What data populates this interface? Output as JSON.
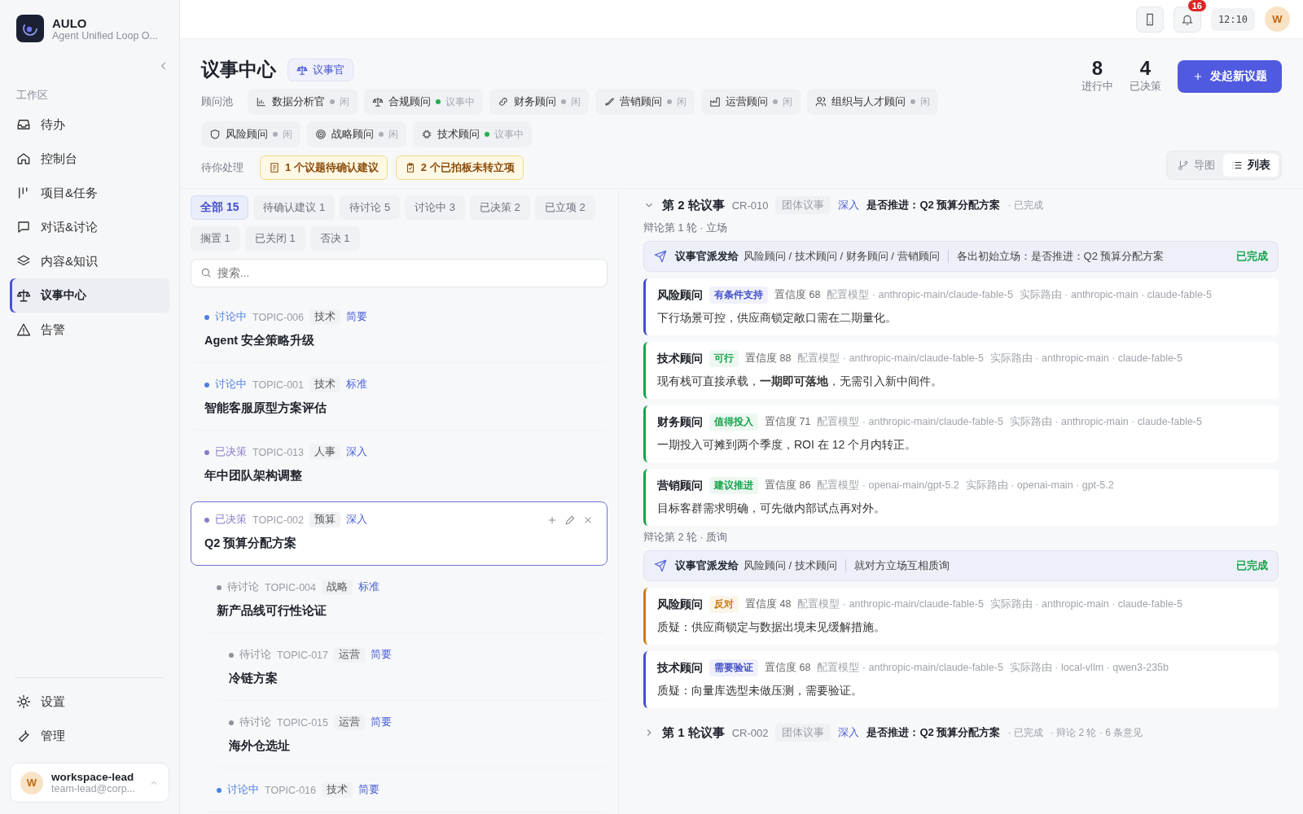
{
  "sidebar": {
    "logo": {
      "title": "AULO",
      "subtitle": "Agent Unified Loop O..."
    },
    "section_label": "工作区",
    "items": [
      {
        "label": "待办",
        "selected": false
      },
      {
        "label": "控制台",
        "selected": false
      },
      {
        "label": "项目&任务",
        "selected": false
      },
      {
        "label": "对话&讨论",
        "selected": false
      },
      {
        "label": "内容&知识",
        "selected": false
      },
      {
        "label": "议事中心",
        "selected": true
      },
      {
        "label": "告警",
        "selected": false
      }
    ],
    "bottom_items": [
      {
        "label": "设置"
      },
      {
        "label": "管理"
      }
    ],
    "user": {
      "initial": "W",
      "name": "workspace-lead",
      "email": "team-lead@corp..."
    }
  },
  "topbar": {
    "notification_count": "16",
    "time": "12:10",
    "avatar": "W"
  },
  "header": {
    "title": "议事中心",
    "role_badge": "议事官",
    "stats": [
      {
        "value": "8",
        "label": "进行中"
      },
      {
        "value": "4",
        "label": "已决策"
      }
    ],
    "new_button": "发起新议题",
    "pool_label": "顾问池",
    "advisors": [
      {
        "name": "数据分析官",
        "status": "闲",
        "active": false
      },
      {
        "name": "合规顾问",
        "status": "议事中",
        "active": true
      },
      {
        "name": "财务顾问",
        "status": "闲",
        "active": false
      },
      {
        "name": "营销顾问",
        "status": "闲",
        "active": false
      },
      {
        "name": "运营顾问",
        "status": "闲",
        "active": false
      },
      {
        "name": "组织与人才顾问",
        "status": "闲",
        "active": false
      },
      {
        "name": "风险顾问",
        "status": "闲",
        "active": false
      },
      {
        "name": "战略顾问",
        "status": "闲",
        "active": false
      },
      {
        "name": "技术顾问",
        "status": "议事中",
        "active": true
      }
    ],
    "pending_label": "待你处理",
    "pending": [
      "1 个议题待确认建议",
      "2 个已拍板未转立项"
    ],
    "view_toggle": [
      {
        "label": "导图",
        "selected": false
      },
      {
        "label": "列表",
        "selected": true
      }
    ]
  },
  "filters": [
    {
      "label": "全部 15",
      "selected": true
    },
    {
      "label": "待确认建议 1",
      "selected": false
    },
    {
      "label": "待讨论 5",
      "selected": false
    },
    {
      "label": "讨论中 3",
      "selected": false
    },
    {
      "label": "已决策 2",
      "selected": false
    },
    {
      "label": "已立项 2",
      "selected": false
    },
    {
      "label": "搁置 1",
      "selected": false
    },
    {
      "label": "已关闭 1",
      "selected": false
    },
    {
      "label": "否决 1",
      "selected": false
    }
  ],
  "search": {
    "placeholder": "搜索..."
  },
  "topics": [
    {
      "status": "讨论中",
      "color": "#4f7fe0",
      "id": "TOPIC-006",
      "tag": "技术",
      "depth": "简要",
      "title": "Agent 安全策略升级",
      "selected": false
    },
    {
      "status": "讨论中",
      "color": "#4f7fe0",
      "id": "TOPIC-001",
      "tag": "技术",
      "depth": "标准",
      "title": "智能客服原型方案评估",
      "selected": false
    },
    {
      "status": "已决策",
      "color": "#8a7cc8",
      "id": "TOPIC-013",
      "tag": "人事",
      "depth": "深入",
      "title": "年中团队架构调整",
      "selected": false
    },
    {
      "status": "已决策",
      "color": "#8a7cc8",
      "id": "TOPIC-002",
      "tag": "预算",
      "depth": "深入",
      "title": "Q2 预算分配方案",
      "selected": true,
      "children": [
        {
          "status": "待讨论",
          "color": "#8d9199",
          "id": "TOPIC-004",
          "tag": "战略",
          "depth": "标准",
          "title": "新产品线可行性论证",
          "selected": false,
          "children": [
            {
              "status": "待讨论",
              "color": "#8d9199",
              "id": "TOPIC-017",
              "tag": "运营",
              "depth": "简要",
              "title": "冷链方案",
              "selected": false
            },
            {
              "status": "待讨论",
              "color": "#8d9199",
              "id": "TOPIC-015",
              "tag": "运营",
              "depth": "简要",
              "title": "海外仓选址",
              "selected": false
            }
          ]
        },
        {
          "status": "讨论中",
          "color": "#4f7fe0",
          "id": "TOPIC-016",
          "tag": "技术",
          "depth": "简要",
          "selected": false
        }
      ]
    }
  ],
  "sessions": [
    {
      "expanded": true,
      "title": "第 2 轮议事",
      "code": "CR-010",
      "type": "团体议事",
      "depth": "深入",
      "question": "是否推进：Q2 预算分配方案",
      "status": "· 已完成",
      "rounds": [
        {
          "label": "辩论第 1 轮 · 立场",
          "dispatch": {
            "from": "议事官派发给",
            "to": "风险顾问 / 技术顾问 / 财务顾问 / 营销顾问",
            "instruction": "各出初始立场：是否推进：Q2 预算分配方案",
            "status": "已完成"
          },
          "opinions": [
            {
              "advisor": "风险顾问",
              "stance": "有条件支持",
              "color": "#4350c9",
              "confidence": "置信度 68",
              "model": "配置模型 · anthropic-main/claude-fable-5",
              "route": "实际路由 · anthropic-main · claude-fable-5",
              "text": "下行场景可控，供应商锁定敞口需在二期量化。"
            },
            {
              "advisor": "技术顾问",
              "stance": "可行",
              "color": "#16a34a",
              "confidence": "置信度 88",
              "model": "配置模型 · anthropic-main/claude-fable-5",
              "route": "实际路由 · anthropic-main · claude-fable-5",
              "text": "现有栈可直接承载，**一期即可落地**，无需引入新中间件。"
            },
            {
              "advisor": "财务顾问",
              "stance": "值得投入",
              "color": "#16a34a",
              "confidence": "置信度 71",
              "model": "配置模型 · anthropic-main/claude-fable-5",
              "route": "实际路由 · anthropic-main · claude-fable-5",
              "text": "一期投入可摊到两个季度，ROI 在 12 个月内转正。"
            },
            {
              "advisor": "营销顾问",
              "stance": "建议推进",
              "color": "#16a34a",
              "confidence": "置信度 86",
              "model": "配置模型 · openai-main/gpt-5.2",
              "route": "实际路由 · openai-main · gpt-5.2",
              "text": "目标客群需求明确，可先做内部试点再对外。"
            }
          ]
        },
        {
          "label": "辩论第 2 轮 · 质询",
          "dispatch": {
            "from": "议事官派发给",
            "to": "风险顾问 / 技术顾问",
            "instruction": "就对方立场互相质询",
            "status": "已完成"
          },
          "opinions": [
            {
              "advisor": "风险顾问",
              "stance": "反对",
              "color": "#cf7a0a",
              "confidence": "置信度 48",
              "model": "配置模型 · anthropic-main/claude-fable-5",
              "route": "实际路由 · anthropic-main · claude-fable-5",
              "text": "质疑：供应商锁定与数据出境未见缓解措施。"
            },
            {
              "advisor": "技术顾问",
              "stance": "需要验证",
              "color": "#4350c9",
              "confidence": "置信度 68",
              "model": "配置模型 · anthropic-main/claude-fable-5",
              "route": "实际路由 · local-vllm · qwen3-235b",
              "text": "质疑：向量库选型未做压测，需要验证。"
            }
          ]
        }
      ]
    },
    {
      "expanded": false,
      "title": "第 1 轮议事",
      "code": "CR-002",
      "type": "团体议事",
      "depth": "深入",
      "question": "是否推进：Q2 预算分配方案",
      "status": "· 已完成",
      "summary": "· 辩论 2 轮 · 6 条意见"
    }
  ]
}
